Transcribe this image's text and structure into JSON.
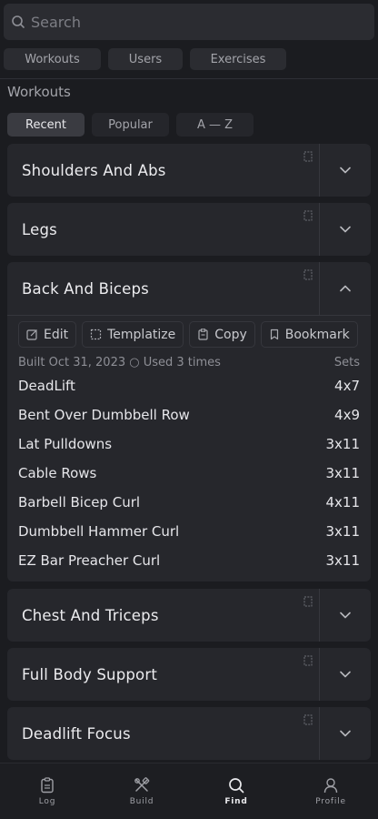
{
  "search": {
    "placeholder": "Search"
  },
  "filters": [
    {
      "label": "Workouts"
    },
    {
      "label": "Users"
    },
    {
      "label": "Exercises"
    }
  ],
  "section": {
    "title": "Workouts"
  },
  "tabs": [
    {
      "label": "Recent"
    },
    {
      "label": "Popular"
    },
    {
      "label": "A — Z"
    }
  ],
  "workouts": [
    {
      "title": "Shoulders And Abs"
    },
    {
      "title": "Legs"
    },
    {
      "title": "Back And Biceps",
      "expanded": true,
      "actions": [
        {
          "label": "Edit",
          "icon": "edit-icon"
        },
        {
          "label": "Templatize",
          "icon": "templatize-icon"
        },
        {
          "label": "Copy",
          "icon": "copy-icon"
        },
        {
          "label": "Bookmark",
          "icon": "bookmark-icon"
        }
      ],
      "meta": "Built Oct 31, 2023 ○ Used 3 times",
      "sets_header": "Sets",
      "exercises": [
        {
          "name": "DeadLift",
          "sets": "4x7"
        },
        {
          "name": "Bent Over Dumbbell Row",
          "sets": "4x9"
        },
        {
          "name": "Lat Pulldowns",
          "sets": "3x11"
        },
        {
          "name": "Cable Rows",
          "sets": "3x11"
        },
        {
          "name": "Barbell Bicep Curl",
          "sets": "4x11"
        },
        {
          "name": "Dumbbell Hammer Curl",
          "sets": "3x11"
        },
        {
          "name": "EZ Bar Preacher Curl",
          "sets": "3x11"
        }
      ]
    },
    {
      "title": "Chest And Triceps"
    },
    {
      "title": "Full Body Support"
    },
    {
      "title": "Deadlift Focus"
    }
  ],
  "nav": [
    {
      "label": "Log",
      "icon": "log-icon"
    },
    {
      "label": "Build",
      "icon": "build-icon"
    },
    {
      "label": "Find",
      "icon": "search-icon",
      "active": true
    },
    {
      "label": "Profile",
      "icon": "profile-icon"
    }
  ],
  "colors": {
    "background": "#1b1c20",
    "card": "#26272c",
    "text": "#e9e9ec",
    "muted": "#a3a4aa"
  }
}
